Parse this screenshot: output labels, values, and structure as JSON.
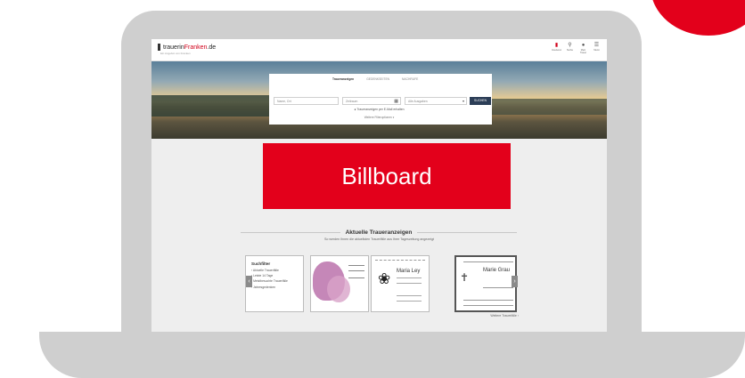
{
  "site": {
    "logo_prefix": "trauerin",
    "logo_highlight": "Franken",
    "logo_suffix": ".de",
    "logo_sub": "Ein Angebot von Franken"
  },
  "nav": [
    {
      "label": "Inserieren",
      "icon": "candle-icon"
    },
    {
      "label": "Suche",
      "icon": "search-icon"
    },
    {
      "label": "Mein Trauer",
      "icon": "user-icon"
    },
    {
      "label": "Menü",
      "icon": "menu-icon"
    }
  ],
  "search": {
    "tabs": [
      "Traueranzeigen",
      "GEDENKSEITEN",
      "NACHRUFE"
    ],
    "name_placeholder": "Name, Ort",
    "date_placeholder": "Zeitraum",
    "edition_placeholder": "Alle Ausgaben",
    "button_label": "SUCHEN",
    "alert_text": "Traueranzeigen per E-Mail erhalten",
    "more_options": "Weitere Filteroptionen ▾"
  },
  "billboard": {
    "label": "Billboard"
  },
  "section": {
    "title": "Aktuelle Traueranzeigen",
    "subtitle": "So werden Ihnen die aktuellsten Trauerfälle aus Ihrer Tageszeitung angezeigt"
  },
  "quicklinks": {
    "heading": "Suchfilter",
    "items": [
      "Aktuelle Trauerfälle",
      "Letzte 14 Tage",
      "Meistbesuchte Trauerfälle",
      "Jahresgedenken"
    ]
  },
  "notices": [
    {
      "name": "Maria Ley"
    },
    {
      "name": "Marie Grau"
    }
  ],
  "more_link": "Weitere Trauerfälle ›",
  "colors": {
    "brand_red": "#e3001b",
    "button_navy": "#2c3e57",
    "laptop_gray": "#cfcfcf"
  }
}
